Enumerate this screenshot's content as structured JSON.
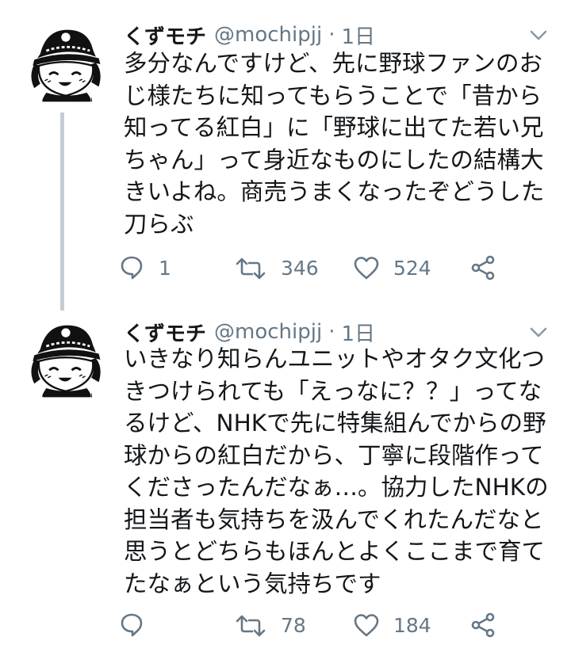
{
  "tweets": [
    {
      "display_name": "くずモチ",
      "handle": "@mochipjj",
      "separator": "·",
      "time": "1日",
      "lines": [
        "多分なんですけど、先に野球ファンのお",
        "じ様たちに知ってもらうことで「昔から",
        "知ってる紅白」に「野球に出てた若い兄",
        "ちゃん」って身近なものにしたの結構大",
        "きいよね。商売うまくなったぞどうした",
        "刀らぶ"
      ],
      "replies": "1",
      "retweets": "346",
      "likes": "524"
    },
    {
      "display_name": "くずモチ",
      "handle": "@mochipjj",
      "separator": "·",
      "time": "1日",
      "lines": [
        "いきなり知らんユニットやオタク文化つ",
        "きつけられても「えっなに？？」ってな",
        "るけど、NHKで先に特集組んでからの野",
        "球からの紅白だから、丁寧に段階作って",
        "くださったんだなぁ…。協力したNHKの",
        "担当者も気持ちを汲んでくれたんだなと",
        "思うとどちらもほんとよくここまで育て",
        "たなぁという気持ちです"
      ],
      "replies": "",
      "retweets": "78",
      "likes": "184"
    }
  ],
  "icons": {
    "reply": "reply-icon",
    "retweet": "retweet-icon",
    "like": "heart-icon",
    "share": "share-icon",
    "menu": "chevron-down-icon"
  },
  "colors": {
    "text": "#14171a",
    "secondary": "#657786",
    "thread_line": "#c5ccd3"
  }
}
